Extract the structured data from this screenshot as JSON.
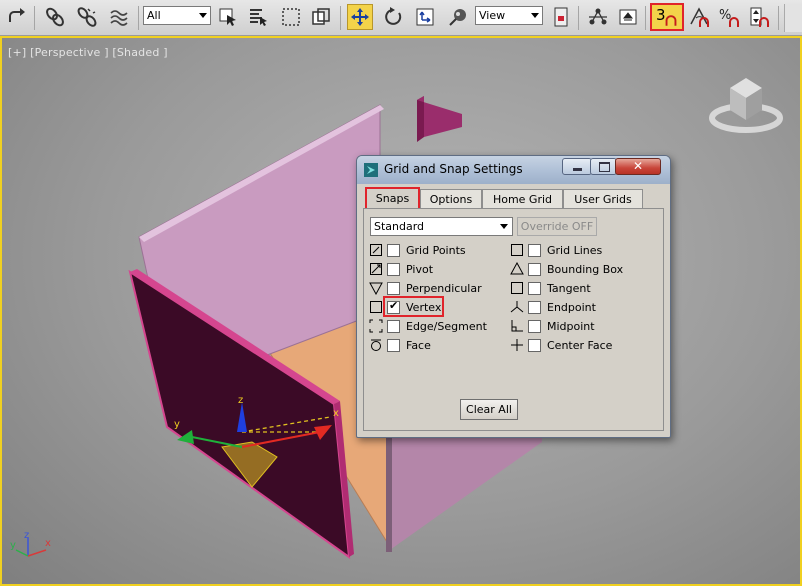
{
  "toolbar": {
    "selection_filter": "All",
    "reference_coord": "View",
    "snap_toggle_label": "3",
    "icons": [
      "redo-icon",
      "select-link-icon",
      "unlink-icon",
      "bind-space-warp-icon",
      "select-object-icon",
      "select-by-name-icon",
      "rectangular-selection-icon",
      "window-crossing-icon",
      "select-move-icon",
      "select-rotate-icon",
      "select-scale-icon",
      "pivot-center-icon",
      "select-manipulate-icon",
      "mirror-icon",
      "align-icon",
      "snap-3d-icon",
      "angle-snap-icon",
      "percent-snap-icon",
      "spinner-snap-icon"
    ]
  },
  "viewport": {
    "label": "[+] [Perspective ] [Shaded ]",
    "gizmo_labels": {
      "x": "x",
      "y": "y",
      "z": "z"
    },
    "axis_tripod": {
      "x": "x",
      "y": "y",
      "z": "z"
    },
    "colors": {
      "border": "#f0d020",
      "wall_pink": "#c99bc0",
      "wall_dark": "#3b0a26",
      "floor": "#e7a878"
    }
  },
  "dialog": {
    "title": "Grid and Snap Settings",
    "tabs": [
      {
        "label": "Snaps",
        "active": true
      },
      {
        "label": "Options",
        "active": false
      },
      {
        "label": "Home Grid",
        "active": false
      },
      {
        "label": "User Grids",
        "active": false
      }
    ],
    "preset": "Standard",
    "override_label": "Override OFF",
    "snaps_left": [
      {
        "label": "Grid Points",
        "checked": false,
        "icon": "grid-points-icon"
      },
      {
        "label": "Pivot",
        "checked": false,
        "icon": "pivot-icon"
      },
      {
        "label": "Perpendicular",
        "checked": false,
        "icon": "perpendicular-icon"
      },
      {
        "label": "Vertex",
        "checked": true,
        "icon": "vertex-icon"
      },
      {
        "label": "Edge/Segment",
        "checked": false,
        "icon": "edge-segment-icon"
      },
      {
        "label": "Face",
        "checked": false,
        "icon": "face-icon"
      }
    ],
    "snaps_right": [
      {
        "label": "Grid Lines",
        "checked": false,
        "icon": "grid-lines-icon"
      },
      {
        "label": "Bounding Box",
        "checked": false,
        "icon": "bounding-box-icon"
      },
      {
        "label": "Tangent",
        "checked": false,
        "icon": "tangent-icon"
      },
      {
        "label": "Endpoint",
        "checked": false,
        "icon": "endpoint-icon"
      },
      {
        "label": "Midpoint",
        "checked": false,
        "icon": "midpoint-icon"
      },
      {
        "label": "Center Face",
        "checked": false,
        "icon": "center-face-icon"
      }
    ],
    "clear_all_label": "Clear All"
  }
}
